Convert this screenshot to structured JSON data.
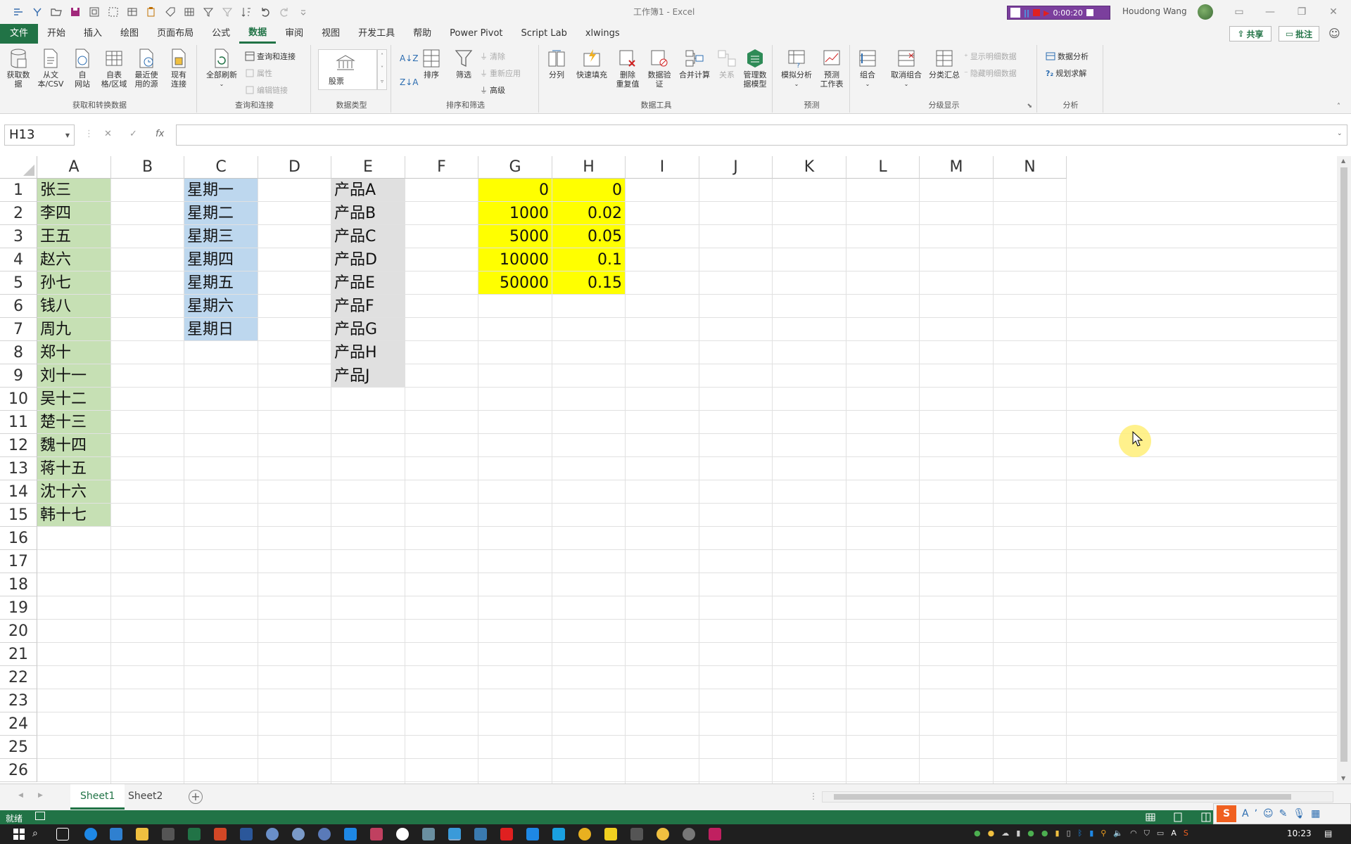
{
  "title_bar": {
    "doc_title": "工作簿1  -  Excel",
    "recording_time": "0:00:20",
    "user_name": "Houdong Wang"
  },
  "ribbon_tabs": [
    "文件",
    "开始",
    "插入",
    "绘图",
    "页面布局",
    "公式",
    "数据",
    "审阅",
    "视图",
    "开发工具",
    "帮助",
    "Power Pivot",
    "Script Lab",
    "xlwings"
  ],
  "active_tab": "数据",
  "share_label": "共享",
  "comment_label": "批注",
  "ribbon_groups": {
    "get_transform": {
      "label": "获取和转换数据",
      "buttons": [
        "获取数\n据",
        "从文\n本/CSV",
        "自\n网站",
        "自表\n格/区域",
        "最近使\n用的源",
        "现有\n连接"
      ]
    },
    "queries": {
      "label": "查询和连接",
      "refresh": "全部刷新",
      "items": [
        "查询和连接",
        "属性",
        "编辑链接"
      ]
    },
    "data_types": {
      "label": "数据类型",
      "stocks": "股票"
    },
    "sort_filter": {
      "label": "排序和筛选",
      "sort": "排序",
      "filter": "筛选",
      "items": [
        "清除",
        "重新应用",
        "高级"
      ]
    },
    "data_tools": {
      "label": "数据工具",
      "buttons": [
        "分列",
        "快速填充",
        "删除\n重复值",
        "数据验\n证",
        "合并计算",
        "关系",
        "管理数\n据模型"
      ]
    },
    "forecast": {
      "label": "预测",
      "buttons": [
        "模拟分析",
        "预测\n工作表"
      ]
    },
    "outline": {
      "label": "分级显示",
      "buttons": [
        "组合",
        "取消组合",
        "分类汇总"
      ],
      "items": [
        "显示明细数据",
        "隐藏明细数据"
      ]
    },
    "analysis": {
      "label": "分析",
      "items": [
        "数据分析",
        "规划求解"
      ]
    }
  },
  "formula_bar": {
    "name_box": "H13",
    "fx": "fx",
    "value": ""
  },
  "columns": [
    "A",
    "B",
    "C",
    "D",
    "E",
    "F",
    "G",
    "H",
    "I",
    "J",
    "K",
    "L",
    "M",
    "N"
  ],
  "rows": [
    "1",
    "2",
    "3",
    "4",
    "5",
    "6",
    "7",
    "8",
    "9",
    "10",
    "11",
    "12",
    "13",
    "14",
    "15",
    "16",
    "17",
    "18",
    "19",
    "20",
    "21",
    "22",
    "23",
    "24",
    "25",
    "26"
  ],
  "cells": {
    "A": [
      "张三",
      "李四",
      "王五",
      "赵六",
      "孙七",
      "钱八",
      "周九",
      "郑十",
      "刘十一",
      "吴十二",
      "楚十三",
      "魏十四",
      "蒋十五",
      "沈十六",
      "韩十七"
    ],
    "C": [
      "星期一",
      "星期二",
      "星期三",
      "星期四",
      "星期五",
      "星期六",
      "星期日"
    ],
    "E": [
      "产品A",
      "产品B",
      "产品C",
      "产品D",
      "产品E",
      "产品F",
      "产品G",
      "产品H",
      "产品J"
    ],
    "G": [
      "0",
      "1000",
      "5000",
      "10000",
      "50000"
    ],
    "H": [
      "0",
      "0.02",
      "0.05",
      "0.1",
      "0.15"
    ]
  },
  "fills": {
    "A": "#c6e0b4",
    "C": "#bdd7ee",
    "E": "#e0e0e0",
    "GH": "#ffff00"
  },
  "sheets": [
    "Sheet1",
    "Sheet2"
  ],
  "active_sheet": "Sheet1",
  "status": "就绪",
  "clock": "10:23"
}
